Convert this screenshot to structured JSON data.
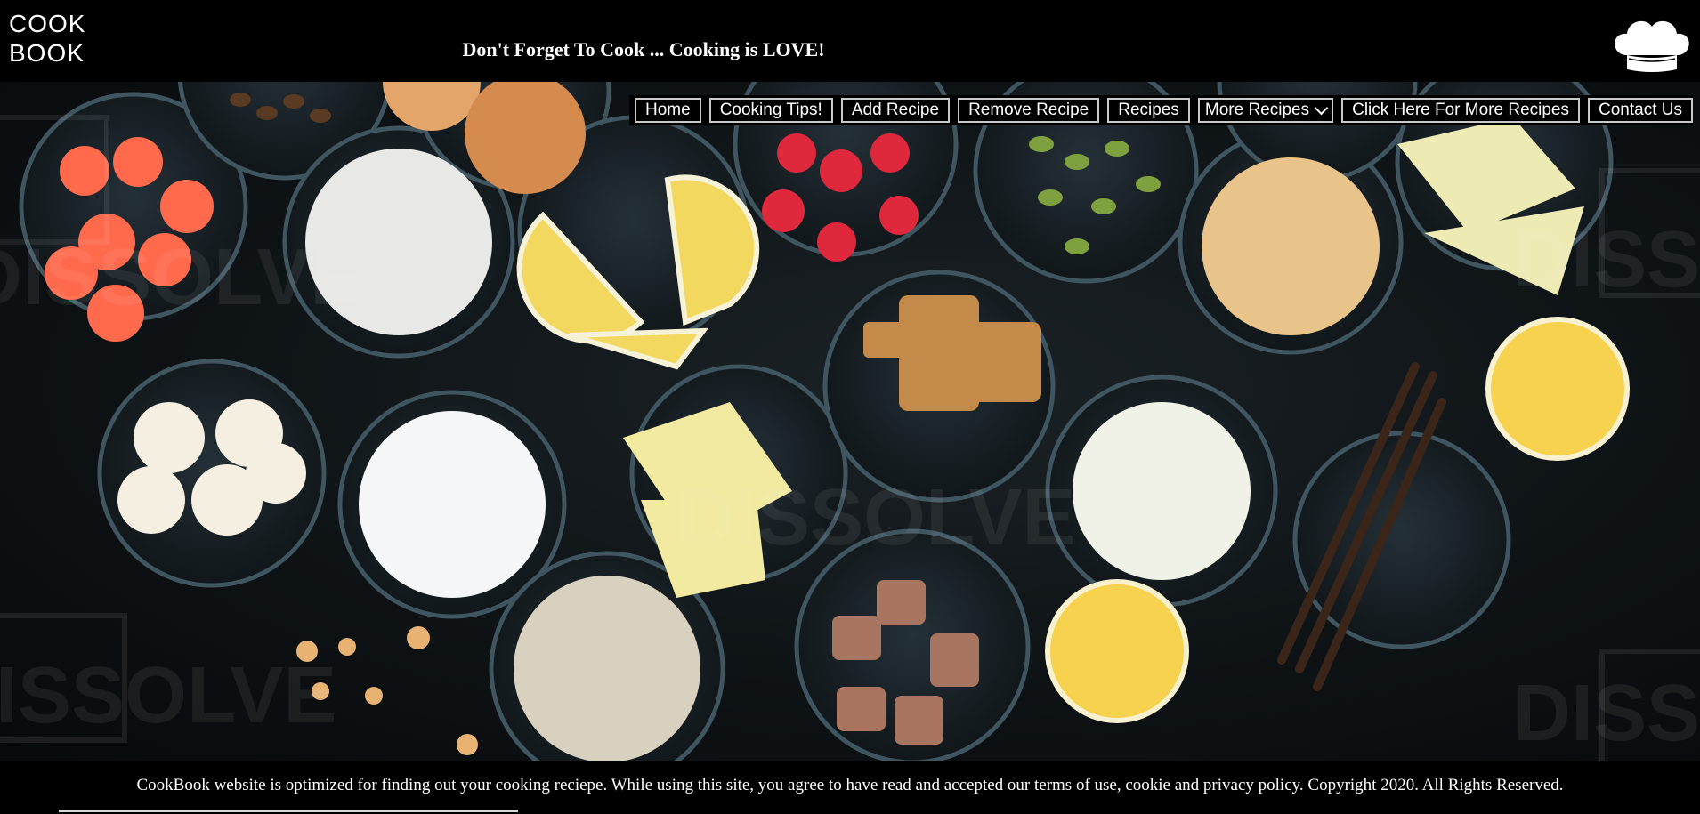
{
  "header": {
    "logo_line1": "COOK",
    "logo_line2": "BOOK",
    "tagline": "Don't Forget To Cook ... Cooking is LOVE!"
  },
  "nav": {
    "home": "Home",
    "cooking_tips": "Cooking Tips!",
    "add_recipe": "Add Recipe",
    "remove_recipe": "Remove Recipe",
    "recipes": "Recipes",
    "more_recipes": "More Recipes",
    "more_recipes_link": "Click Here For More Recipes",
    "contact_us": "Contact Us"
  },
  "hero": {
    "watermark": "DISSOLVE"
  },
  "footer": {
    "text": "CookBook website is optimized for finding out your cooking reciepe. While using this site, you agree to have read and accepted our terms of use, cookie and privacy policy. Copyright 2020. All Rights Reserved."
  },
  "colors": {
    "header_bg": "#000000",
    "text": "#ffffff",
    "nav_border": "#c9c9c9"
  }
}
